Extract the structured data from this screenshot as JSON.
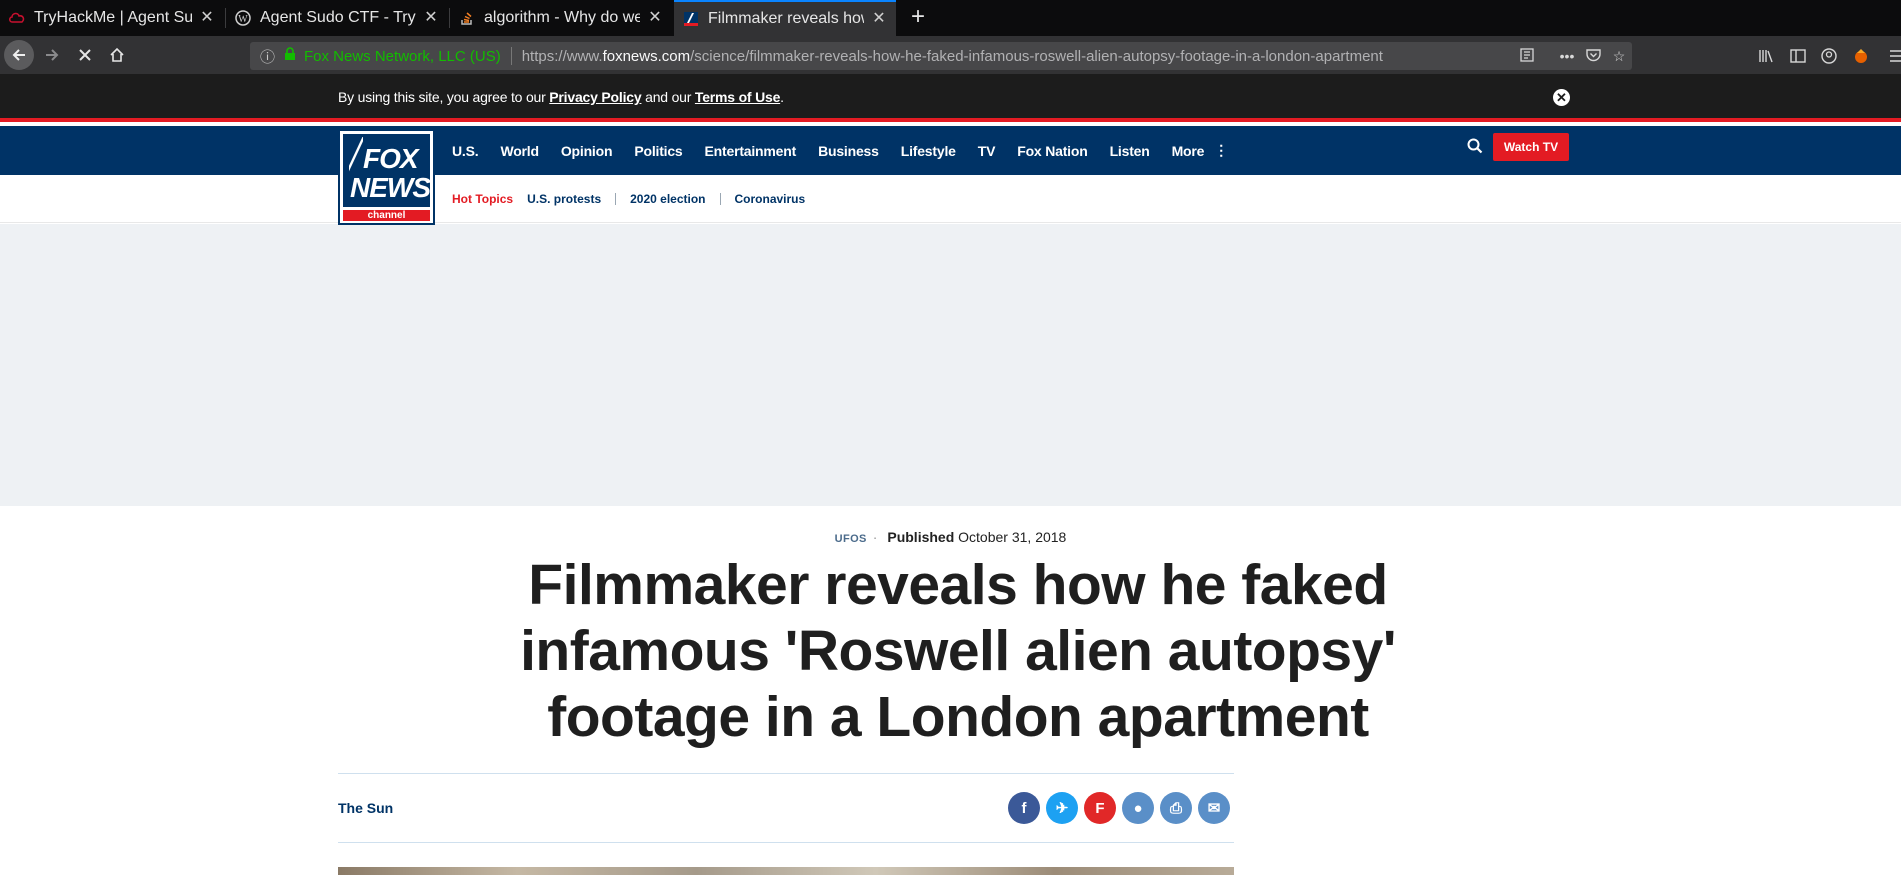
{
  "browser": {
    "tabs": [
      {
        "title": "TryHackMe | Agent Sudo",
        "favicon": "thm-icon"
      },
      {
        "title": "Agent Sudo CTF - Try Ha",
        "favicon": "wordpress-icon"
      },
      {
        "title": "algorithm - Why do we u",
        "favicon": "stackoverflow-icon"
      },
      {
        "title": "Filmmaker reveals how h",
        "favicon": "foxnews-icon",
        "active": true
      }
    ],
    "new_tab_label": "+",
    "url_org": "Fox News Network, LLC (US)",
    "url_prefix": "https://www.",
    "url_domain": "foxnews.com",
    "url_path": "/science/filmmaker-reveals-how-he-faked-infamous-roswell-alien-autopsy-footage-in-a-london-apartment"
  },
  "consent": {
    "prefix": "By using this site, you agree to our ",
    "privacy_label": "Privacy Policy",
    "middle": " and our ",
    "terms_label": "Terms of Use",
    "suffix": ".",
    "close_label": "✕"
  },
  "logo": {
    "fox": "FOX",
    "news": "NEWS",
    "channel": "channel"
  },
  "nav": {
    "items": [
      "U.S.",
      "World",
      "Opinion",
      "Politics",
      "Entertainment",
      "Business",
      "Lifestyle",
      "TV",
      "Fox Nation",
      "Listen"
    ],
    "more_label": "More",
    "watch_label": "Watch TV"
  },
  "subnav": {
    "hot_label": "Hot Topics",
    "items": [
      "U.S. protests",
      "2020 election",
      "Coronavirus"
    ]
  },
  "article": {
    "category": "UFOS",
    "published_label": "Published",
    "date": "October 31, 2018",
    "headline": "Filmmaker reveals how he faked infamous 'Roswell alien autopsy' footage in a London apartment",
    "source": "The Sun"
  },
  "share": [
    {
      "name": "facebook-icon",
      "glyph": "f",
      "color": "#3b5998"
    },
    {
      "name": "twitter-icon",
      "glyph": "✈",
      "color": "#1da1f2"
    },
    {
      "name": "flipboard-icon",
      "glyph": "F",
      "color": "#e12828"
    },
    {
      "name": "comment-icon",
      "glyph": "●",
      "color": "#5a8fc8"
    },
    {
      "name": "print-icon",
      "glyph": "⎙",
      "color": "#5a8fc8"
    },
    {
      "name": "email-icon",
      "glyph": "✉",
      "color": "#5a8fc8"
    }
  ],
  "colors": {
    "brand_navy": "#003366",
    "brand_red": "#e31b23",
    "tab_accent": "#0a84ff"
  }
}
